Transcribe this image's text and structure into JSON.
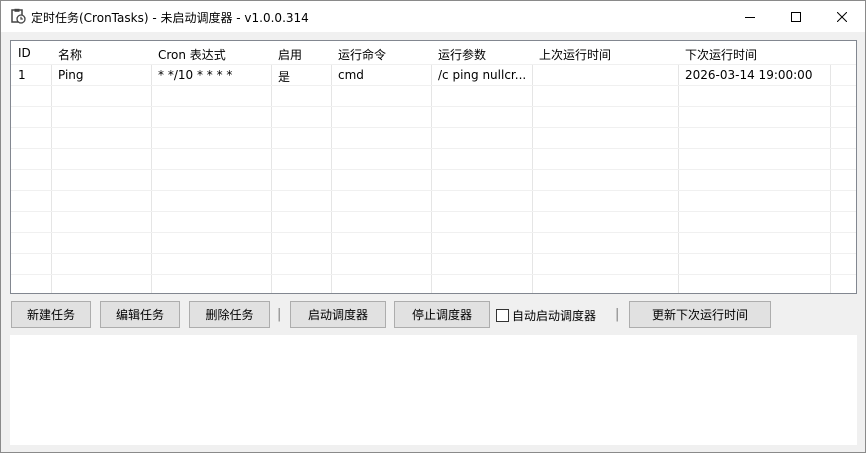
{
  "window": {
    "title": "定时任务(CronTasks) - 未启动调度器 - v1.0.0.314",
    "icon": "clipboard-app-icon"
  },
  "grid": {
    "columns": [
      "ID",
      "名称",
      "Cron 表达式",
      "启用",
      "运行命令",
      "运行参数",
      "上次运行时间",
      "下次运行时间"
    ],
    "rows": [
      [
        "1",
        "Ping",
        "* */10 * * * *",
        "是",
        "cmd",
        "/c ping nullcr...",
        "",
        "2026-03-14 19:00:00"
      ]
    ]
  },
  "toolbar": {
    "new_task": "新建任务",
    "edit_task": "编辑任务",
    "delete_task": "删除任务",
    "separator": "|",
    "start_scheduler": "启动调度器",
    "stop_scheduler": "停止调度器",
    "auto_start_label": "自动启动调度器",
    "update_next_run": "更新下次运行时间"
  },
  "auto_start_checked": false
}
